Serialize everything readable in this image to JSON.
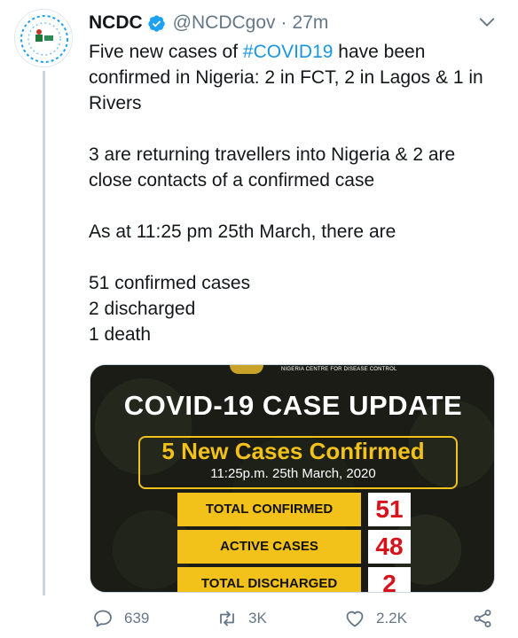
{
  "tweet": {
    "author_name": "NCDC",
    "handle": "@NCDCgov",
    "separator": "·",
    "time": "27m",
    "text": {
      "line1_before": "Five new cases of ",
      "hashtag": "#COVID19",
      "line1_after": " have been confirmed in Nigeria: 2 in FCT, 2 in Lagos & 1 in Rivers",
      "para2": "3 are returning travellers into Nigeria & 2 are close contacts of a confirmed case",
      "para3": "As at 11:25 pm 25th March, there are",
      "stat1": "51 confirmed cases",
      "stat2": "2 discharged",
      "stat3": "1 death"
    }
  },
  "image": {
    "org_name": "NIGERIA CENTRE FOR DISEASE CONTROL",
    "title": "COVID-19 CASE UPDATE",
    "subtitle": "5 New Cases Confirmed",
    "date": "11:25p.m. 25th March, 2020",
    "stats": [
      {
        "label": "TOTAL CONFIRMED",
        "value": "51"
      },
      {
        "label": "ACTIVE CASES",
        "value": "48"
      },
      {
        "label": "TOTAL DISCHARGED",
        "value": "2"
      }
    ],
    "colors": {
      "accent_yellow": "#f3c21a",
      "value_red": "#d8121c",
      "background_dark": "#1a1c15"
    }
  },
  "actions": {
    "reply_count": "639",
    "retweet_count": "3K",
    "like_count": "2.2K",
    "icons": [
      "reply-icon",
      "retweet-icon",
      "like-icon",
      "share-icon"
    ]
  },
  "colors": {
    "link_blue": "#1b95e0",
    "muted_gray": "#657786",
    "verified_blue": "#1da1f2"
  }
}
